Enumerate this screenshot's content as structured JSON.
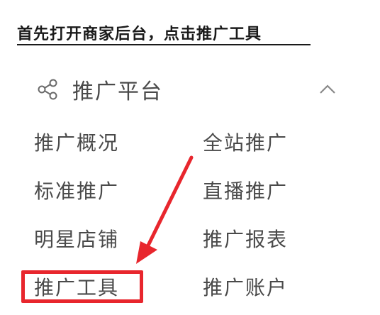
{
  "headline": "首先打开商家后台，点击推广工具",
  "menu": {
    "title": "推广平台",
    "icons": {
      "header": "share-icon",
      "toggle": "chevron-up-icon"
    },
    "items_left": [
      "推广概况",
      "标准推广",
      "明星店铺",
      "推广工具"
    ],
    "items_right": [
      "全站推广",
      "直播推广",
      "推广报表",
      "推广账户"
    ]
  },
  "annotation": {
    "highlight_color": "#e8262d"
  }
}
